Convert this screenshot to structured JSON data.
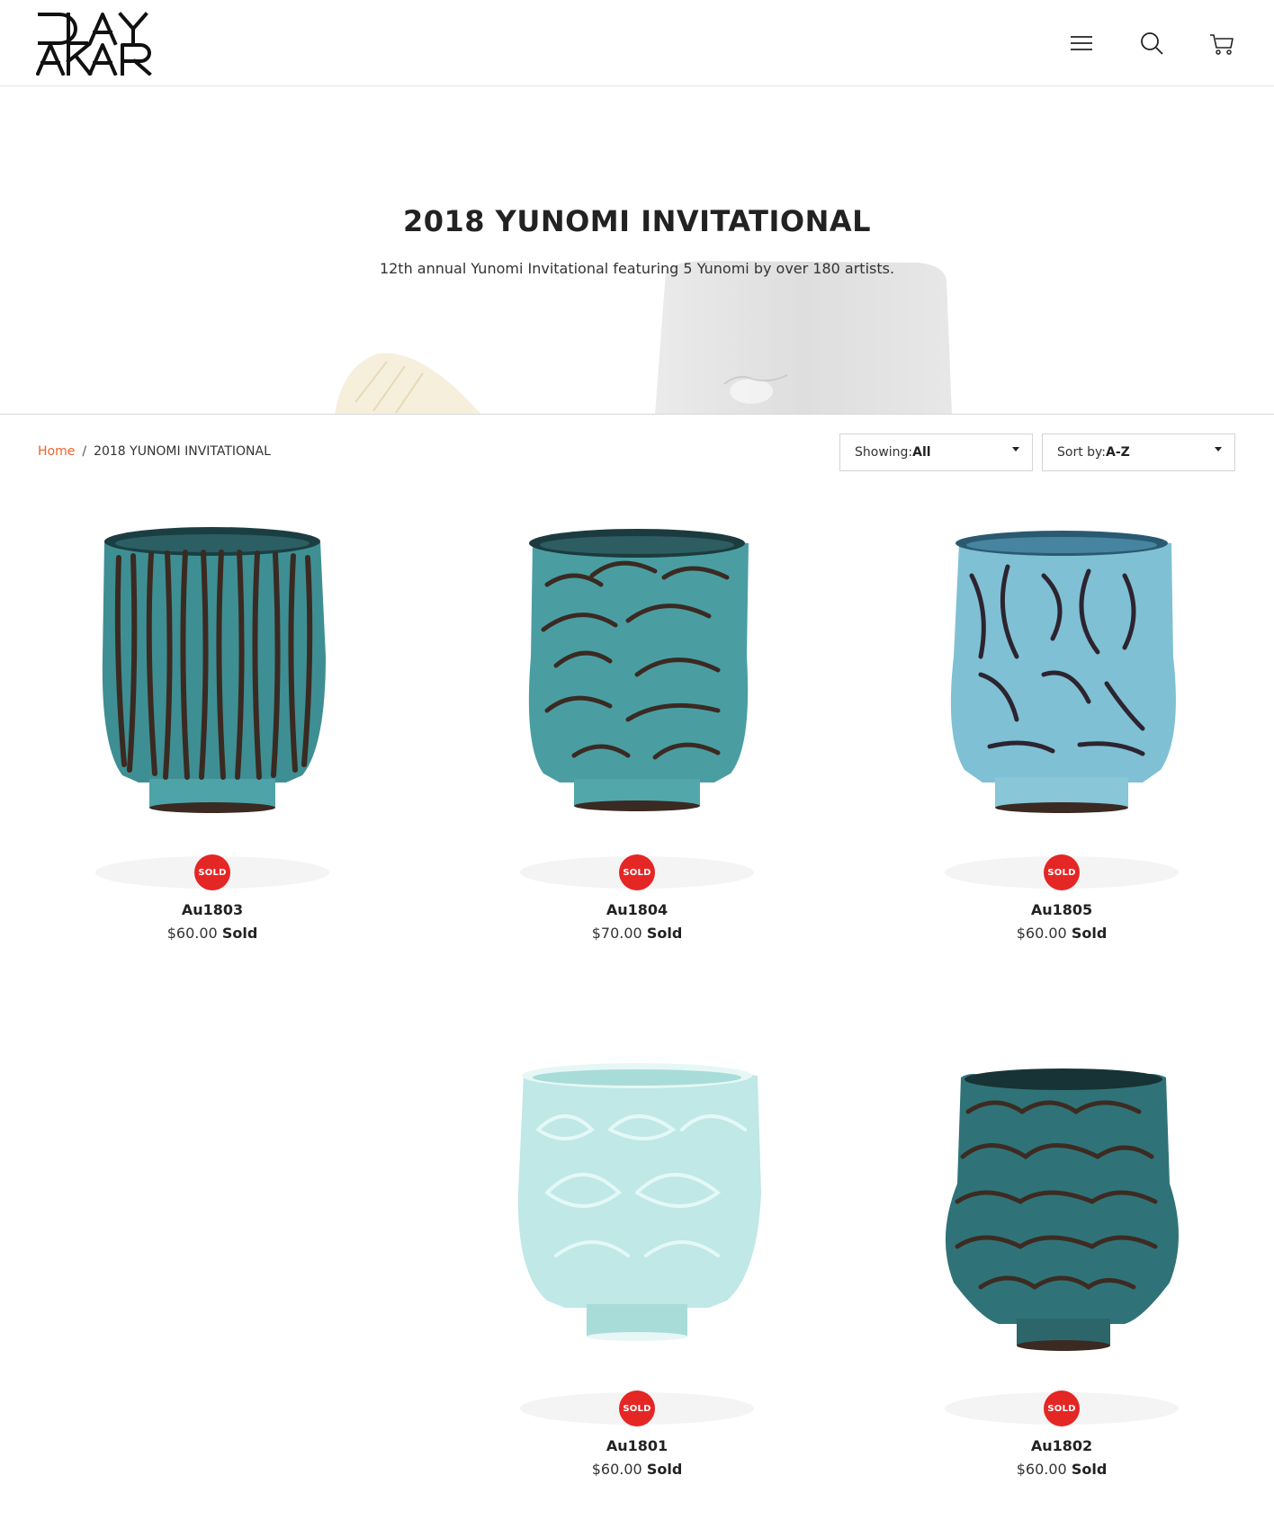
{
  "header": {
    "logo_text": "CLAY AKAR",
    "menu_icon": "hamburger-menu-icon",
    "search_icon": "search-icon",
    "cart_icon": "shopping-cart-icon"
  },
  "hero": {
    "title": "2018 YUNOMI INVITATIONAL",
    "subtitle": "12th annual Yunomi Invitational featuring 5 Yunomi by over 180 artists."
  },
  "breadcrumb": {
    "home": "Home",
    "separator": "/",
    "current": "2018 YUNOMI INVITATIONAL"
  },
  "filters": {
    "showing_label": "Showing:",
    "showing_value": "All",
    "sort_label": "Sort by:",
    "sort_value": "A-Z"
  },
  "colors": {
    "accent": "#e8652c",
    "sold_badge": "#e42625"
  },
  "products": [
    {
      "name": "Au1803",
      "price": "$60.00",
      "status": "Sold",
      "badge": "SOLD"
    },
    {
      "name": "Au1804",
      "price": "$70.00",
      "status": "Sold",
      "badge": "SOLD"
    },
    {
      "name": "Au1805",
      "price": "$60.00",
      "status": "Sold",
      "badge": "SOLD"
    },
    {
      "name": "Au1801",
      "price": "$60.00",
      "status": "Sold",
      "badge": "SOLD"
    },
    {
      "name": "Au1802",
      "price": "$60.00",
      "status": "Sold",
      "badge": "SOLD"
    }
  ]
}
